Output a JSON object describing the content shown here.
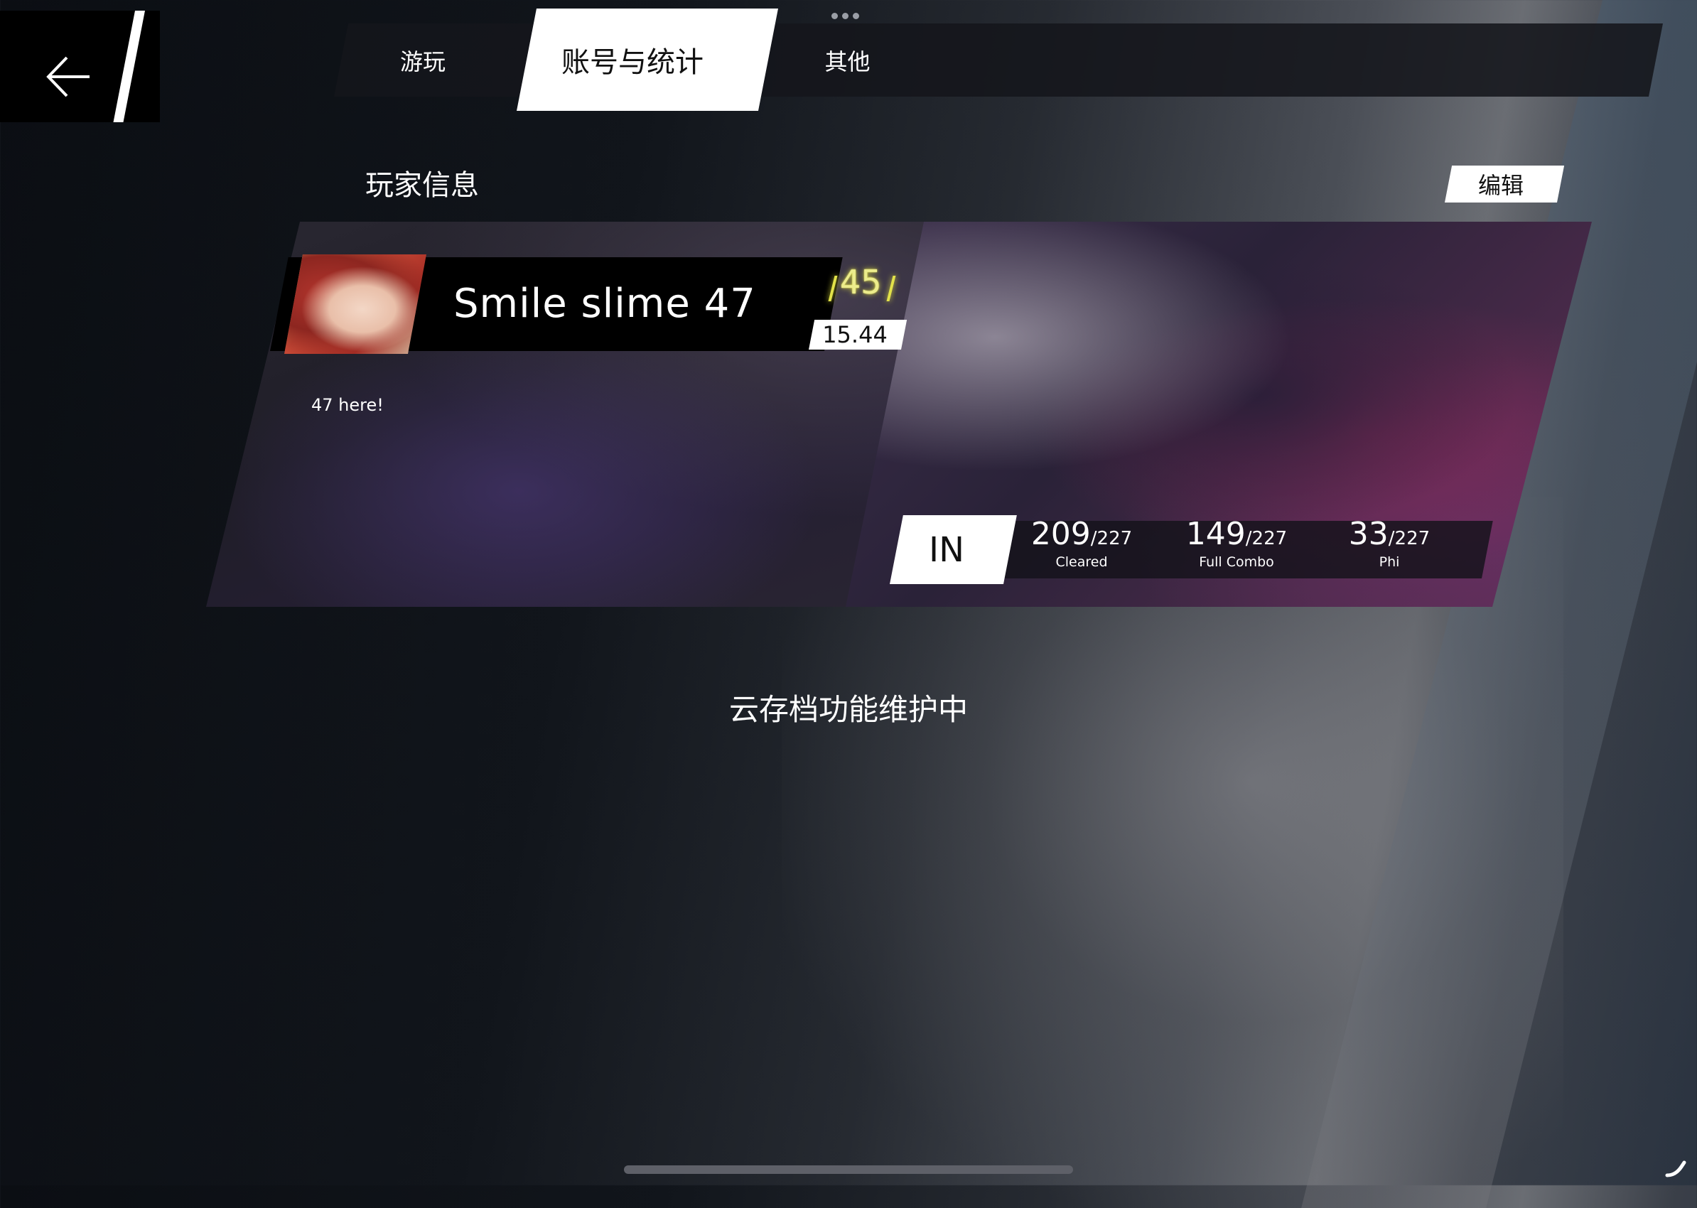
{
  "tabs": [
    {
      "label": "游玩",
      "active": false
    },
    {
      "label": "账号与统计",
      "active": true
    },
    {
      "label": "其他",
      "active": false
    }
  ],
  "section": {
    "title": "玩家信息",
    "edit_label": "编辑"
  },
  "player": {
    "name": "Smile slime 47",
    "level": "45",
    "rks": "15.44",
    "bio": "47 here!"
  },
  "stats": {
    "difficulty": "IN",
    "cleared": {
      "value": "209",
      "total": "/227",
      "label": "Cleared"
    },
    "full_combo": {
      "value": "149",
      "total": "/227",
      "label": "Full Combo"
    },
    "phi": {
      "value": "33",
      "total": "/227",
      "label": "Phi"
    }
  },
  "status_message": "云存档功能维护中",
  "icons": {
    "back": "arrow-left-icon",
    "more": "more-dots-icon",
    "corner": "hook-icon"
  },
  "colors": {
    "level_glow": "#e2e24a",
    "active_tab": "#ffffff",
    "background_dark": "#0b0e13"
  }
}
